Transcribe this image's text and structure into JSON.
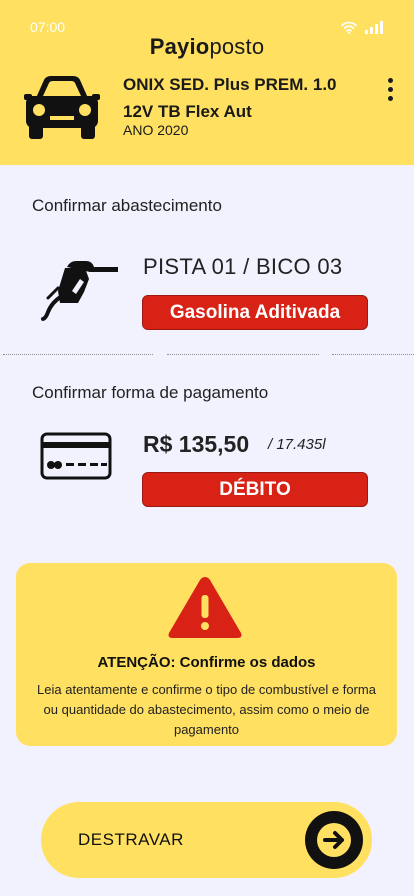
{
  "status_bar": {
    "time": "07:00",
    "wifi_icon": "wifi-icon",
    "signal_icon": "cellular-signal-icon"
  },
  "brand": {
    "part1": "Payio",
    "part2": "posto"
  },
  "vehicle": {
    "icon": "car-icon",
    "name": "ONIX SED. Plus PREM. 1.0 12V TB Flex Aut",
    "year": "ANO 2020"
  },
  "menu_icon": "more-vertical-icon",
  "fuel": {
    "section_title": "Confirmar abastecimento",
    "icon": "fuel-nozzle-icon",
    "pump": "PISTA 01 / BICO 03",
    "fuel_type": "Gasolina Aditivada"
  },
  "payment": {
    "section_title": "Confirmar forma de pagamento",
    "icon": "credit-card-icon",
    "amount": "R$ 135,50",
    "liters": "/ 17.435l",
    "method": "DÉBITO"
  },
  "alert": {
    "icon": "warning-icon",
    "title": "ATENÇÃO: Confirme os dados",
    "body": "Leia atentamente e confirme o tipo de combustível e forma ou quantidade do abastecimento, assim como o meio de pagamento"
  },
  "unlock_button": {
    "label": "DESTRAVAR",
    "icon": "arrow-right-icon"
  },
  "colors": {
    "accent_yellow": "#FFE061",
    "danger_red": "#D82216",
    "background": "#F1F2FE"
  }
}
